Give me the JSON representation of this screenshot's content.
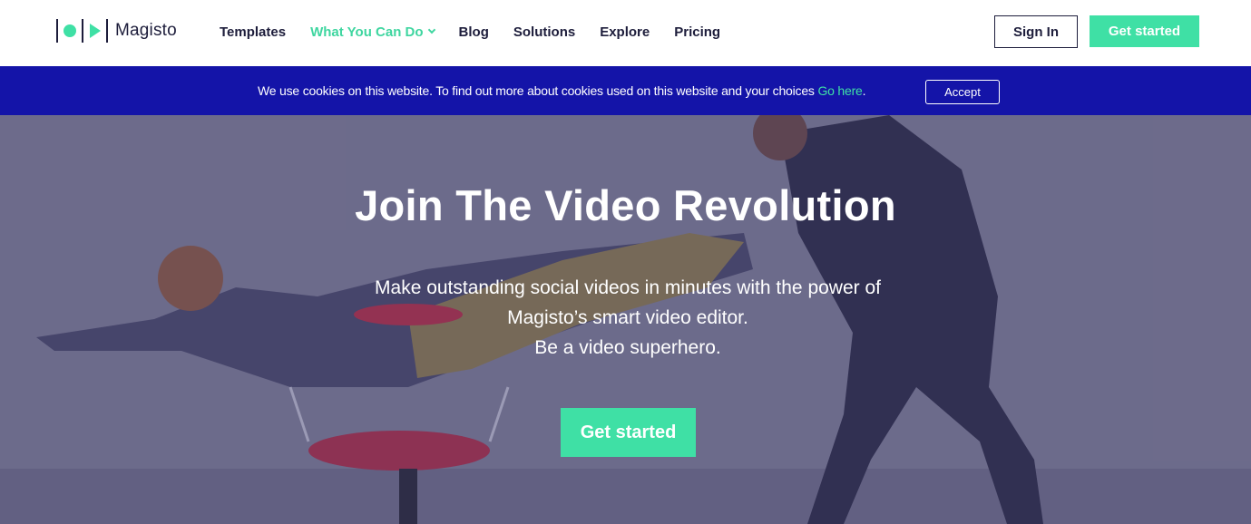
{
  "header": {
    "brand": "Magisto",
    "nav": [
      {
        "label": "Templates"
      },
      {
        "label": "What You Can Do"
      },
      {
        "label": "Blog"
      },
      {
        "label": "Solutions"
      },
      {
        "label": "Explore"
      },
      {
        "label": "Pricing"
      }
    ],
    "signin_label": "Sign In",
    "getstarted_label": "Get started"
  },
  "cookie_banner": {
    "message": "We use cookies on this website. To find out more about cookies used on this website and your choices ",
    "link_text": "Go here",
    "period": ".",
    "accept_label": "Accept"
  },
  "hero": {
    "title": "Join The Video Revolution",
    "subtitle_line1": "Make outstanding social videos in minutes with the power of",
    "subtitle_line2": "Magisto’s smart video editor.",
    "subtitle_line3": "Be a video superhero.",
    "cta_label": "Get started"
  },
  "colors": {
    "accent": "#3fe0a5",
    "cookie_bg": "#1414a8",
    "text_dark": "#1d1d3b"
  },
  "icons": [
    "logo-dot-icon",
    "logo-play-icon",
    "chevron-down-icon"
  ]
}
